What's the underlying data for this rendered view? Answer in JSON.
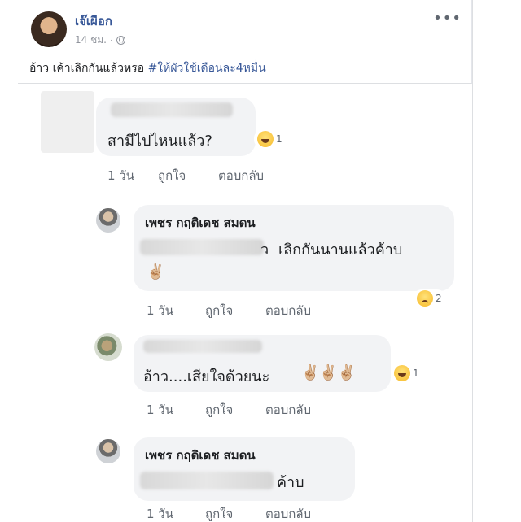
{
  "post": {
    "author": "เจ๊เผือก",
    "time": "14 ชม.",
    "dot": "·",
    "text_prefix": "อ้าว เค้าเลิกกันแล้วหรอ ",
    "hashtag": "#ให้ผัวใช้เดือนละ4หมื่น"
  },
  "comments": [
    {
      "text": "สามีไปไหนแล้ว?",
      "reaction_count": "1",
      "time": "1 วัน",
      "like": "ถูกใจ",
      "reply": "ตอบกลับ"
    },
    {
      "name": "เพชร กฤติเดช สมดน",
      "text": "เลิกกันนานแล้วค้าบ",
      "prefix_char": "ว",
      "emoji_line": "✌🏼",
      "reaction_count": "2",
      "time": "1 วัน",
      "like": "ถูกใจ",
      "reply": "ตอบกลับ"
    },
    {
      "text": "อ้าว....เสียใจด้วยนะ",
      "emojis": "✌🏼✌🏼✌🏼",
      "reaction_count": "1",
      "time": "1 วัน",
      "like": "ถูกใจ",
      "reply": "ตอบกลับ"
    },
    {
      "name": "เพชร กฤติเดช สมดน",
      "text": "ค้าบ",
      "time": "1 วัน",
      "like": "ถูกใจ",
      "reply": "ตอบกลับ"
    }
  ],
  "icons": [
    "globe-icon",
    "more-icon",
    "laugh-reaction-icon",
    "sad-reaction-icon"
  ]
}
